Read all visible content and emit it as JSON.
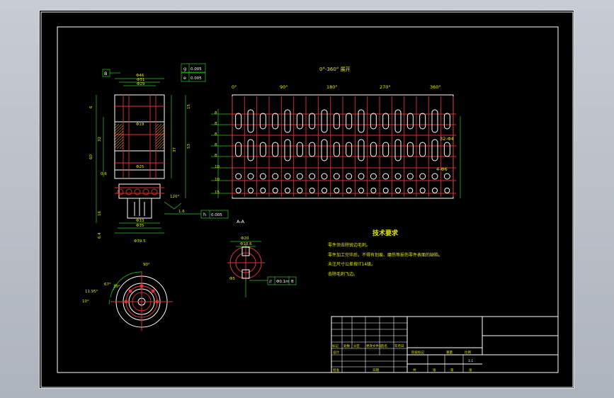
{
  "drawing": {
    "unroll_title": "0°-360° 展开",
    "angle_labels": [
      "0°",
      "90°",
      "180°",
      "270°",
      "360°"
    ],
    "unroll_annotation": "32-Φ4",
    "label_45": "4-Φ6",
    "ls_row_values": [
      "8",
      "8",
      "8",
      "8",
      "8",
      "10",
      "10",
      "15"
    ],
    "section_title": "A-A",
    "dims": {
      "d46": "Φ46",
      "d31": "Φ31",
      "d29": "Φ29",
      "d19": "Φ19",
      "d25": "Φ25",
      "d33": "Φ33",
      "d35": "Φ35",
      "d39": "Φ39",
      "d39_5": "Φ39.5",
      "L60": "60",
      "L32": "32",
      "L37": "37",
      "L53": "53",
      "L35": "35",
      "L16": "16",
      "L6": "6",
      "L15": "15",
      "d20": "Φ20",
      "d10_6": "Φ10.6",
      "d5": "Φ5",
      "ang90": "90°",
      "ang67": "67°",
      "ang11": "11.95°",
      "ang10": "10°",
      "ang30": "30°",
      "ang120": "120°",
      "L6_4": "6.4",
      "L0_6": "0.6",
      "L1_6": "1.6"
    },
    "tolerances": {
      "g": "g",
      "g_val": "0.005",
      "e": "e",
      "e_val": "0.005",
      "h": "h",
      "h_val": "0.005",
      "cyl": "//",
      "cyl_val": "Φ0.1m",
      "cyl_ref": "B",
      "datum_b": "B"
    },
    "tech_title": "技术要求",
    "tech_notes": [
      "零件须去除锐边毛刺。",
      "零件加工完毕后，不得有划痕、磨伤等损伤零件表面的缺陷。",
      "未注尺寸公差按IT14级。",
      "去除毛刺飞边。"
    ],
    "title_block": {
      "row_labels": [
        "标记",
        "处数",
        "分区",
        "更改文件号",
        "签名",
        "年月日"
      ],
      "design": "设计",
      "stage": "阶段标记",
      "weight": "重量",
      "scale_label": "比例",
      "scale": "1:1",
      "approve": "批准",
      "sheet_total": "共",
      "sheet_label": "张",
      "sheet_no": "第",
      "sheet_label2": "张",
      "date": "日期"
    }
  }
}
